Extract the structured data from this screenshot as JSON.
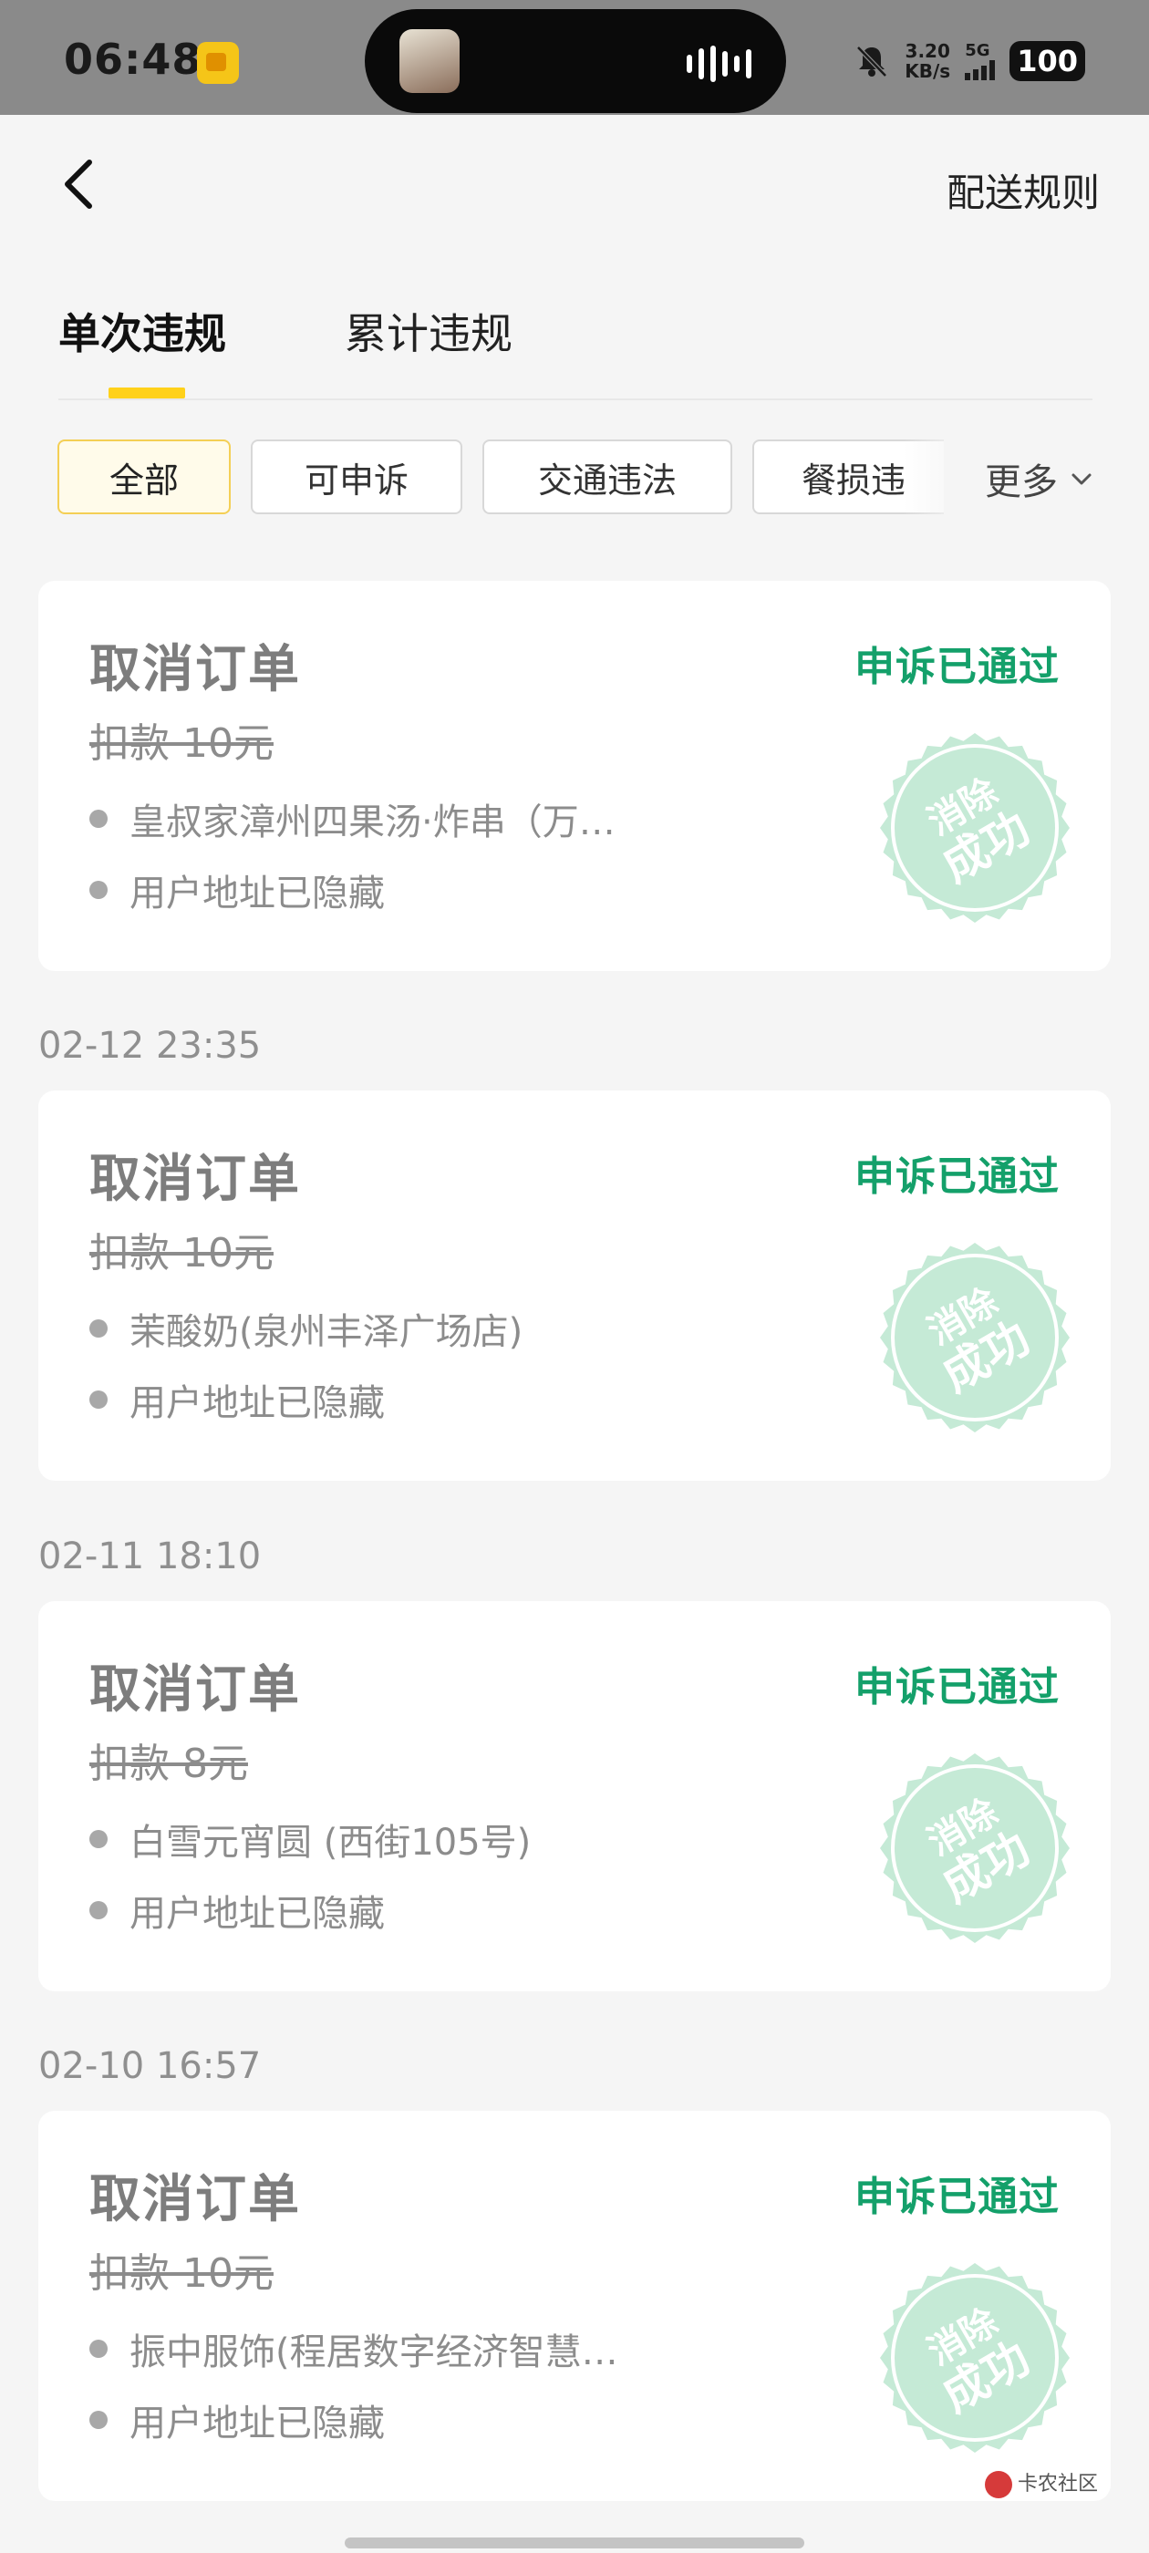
{
  "status_bar": {
    "time": "06:48",
    "speed_value": "3.20",
    "speed_unit": "KB/s",
    "network": "5G",
    "battery": "100",
    "icons": [
      "app-notification-icon",
      "bell-muted-icon",
      "signal-icon"
    ]
  },
  "header": {
    "back_icon": "chevron-left-icon",
    "rules_label": "配送规则"
  },
  "tabs": [
    {
      "label": "单次违规",
      "active": true
    },
    {
      "label": "累计违规",
      "active": false
    }
  ],
  "filters": {
    "chips": [
      {
        "label": "全部",
        "active": true
      },
      {
        "label": "可申诉",
        "active": false
      },
      {
        "label": "交通违法",
        "active": false
      },
      {
        "label": "餐损违",
        "active": false
      }
    ],
    "more_label": "更多",
    "more_icon": "chevron-down-icon"
  },
  "records": [
    {
      "date": "",
      "type": "取消订单",
      "status": "申诉已通过",
      "fine": "扣款 10元",
      "store": "皇叔家漳州四果汤·炸串（万…",
      "address": "用户地址已隐藏",
      "stamp_line1": "消除",
      "stamp_line2": "成功"
    },
    {
      "date": "02-12 23:35",
      "type": "取消订单",
      "status": "申诉已通过",
      "fine": "扣款 10元",
      "store": "茉酸奶(泉州丰泽广场店)",
      "address": "用户地址已隐藏",
      "stamp_line1": "消除",
      "stamp_line2": "成功"
    },
    {
      "date": "02-11 18:10",
      "type": "取消订单",
      "status": "申诉已通过",
      "fine": "扣款 8元",
      "store": "白雪元宵圆 (西街105号)",
      "address": "用户地址已隐藏",
      "stamp_line1": "消除",
      "stamp_line2": "成功"
    },
    {
      "date": "02-10 16:57",
      "type": "取消订单",
      "status": "申诉已通过",
      "fine": "扣款 10元",
      "store": "振中服饰(程居数字经济智慧…",
      "address": "用户地址已隐藏",
      "stamp_line1": "消除",
      "stamp_line2": "成功"
    }
  ],
  "watermark": {
    "label": "卡农社区"
  },
  "colors": {
    "accent_yellow": "#ffd11a",
    "status_green": "#14a06a",
    "stamp_green": "#bfe8d2"
  }
}
